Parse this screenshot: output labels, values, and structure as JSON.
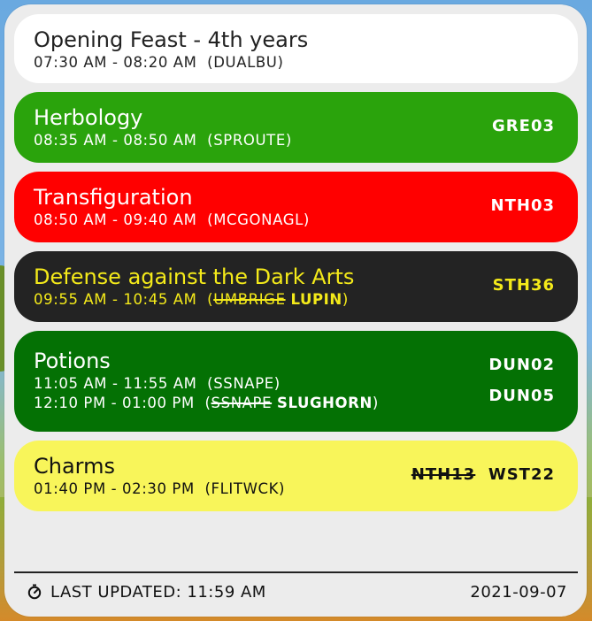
{
  "schedule": [
    {
      "title": "Opening Feast - 4th years",
      "time": "07:30 AM - 08:20 AM",
      "teacher": "DUALBU",
      "colors": {
        "bg": "#ffffff",
        "fg": "#222222"
      }
    },
    {
      "title": "Herbology",
      "time": "08:35 AM - 08:50 AM",
      "teacher": "SPROUTE",
      "room": "GRE03",
      "colors": {
        "bg": "#2aa30c",
        "fg": "#ffffff"
      }
    },
    {
      "title": "Transfiguration",
      "time": "08:50 AM - 09:40 AM",
      "teacher": "MCGONAGL",
      "room": "NTH03",
      "colors": {
        "bg": "#ff0000",
        "fg": "#ffffff"
      }
    },
    {
      "title": "Defense against the Dark Arts",
      "time": "09:55 AM - 10:45 AM",
      "teacher_old": "UMBRIGE",
      "teacher_new": "LUPIN",
      "room": "STH36",
      "colors": {
        "bg": "#232323",
        "fg": "#f4ea1a"
      }
    },
    {
      "title": "Potions",
      "time": "11:05 AM - 11:55 AM",
      "teacher": "SSNAPE",
      "room": "DUN02",
      "time2": "12:10 PM - 01:00 PM",
      "teacher2_old": "SSNAPE",
      "teacher2_new": "SLUGHORN",
      "room2": "DUN05",
      "colors": {
        "bg": "#047104",
        "fg": "#ffffff"
      }
    },
    {
      "title": "Charms",
      "time": "01:40 PM - 02:30 PM",
      "teacher": "FLITWCK",
      "room_old": "NTH13",
      "room_new": "WST22",
      "colors": {
        "bg": "#f8f55a",
        "fg": "#111111"
      }
    }
  ],
  "footer": {
    "icon": "stopwatch-icon",
    "last_updated": "LAST UPDATED: 11:59 AM",
    "date": "2021-09-07"
  }
}
